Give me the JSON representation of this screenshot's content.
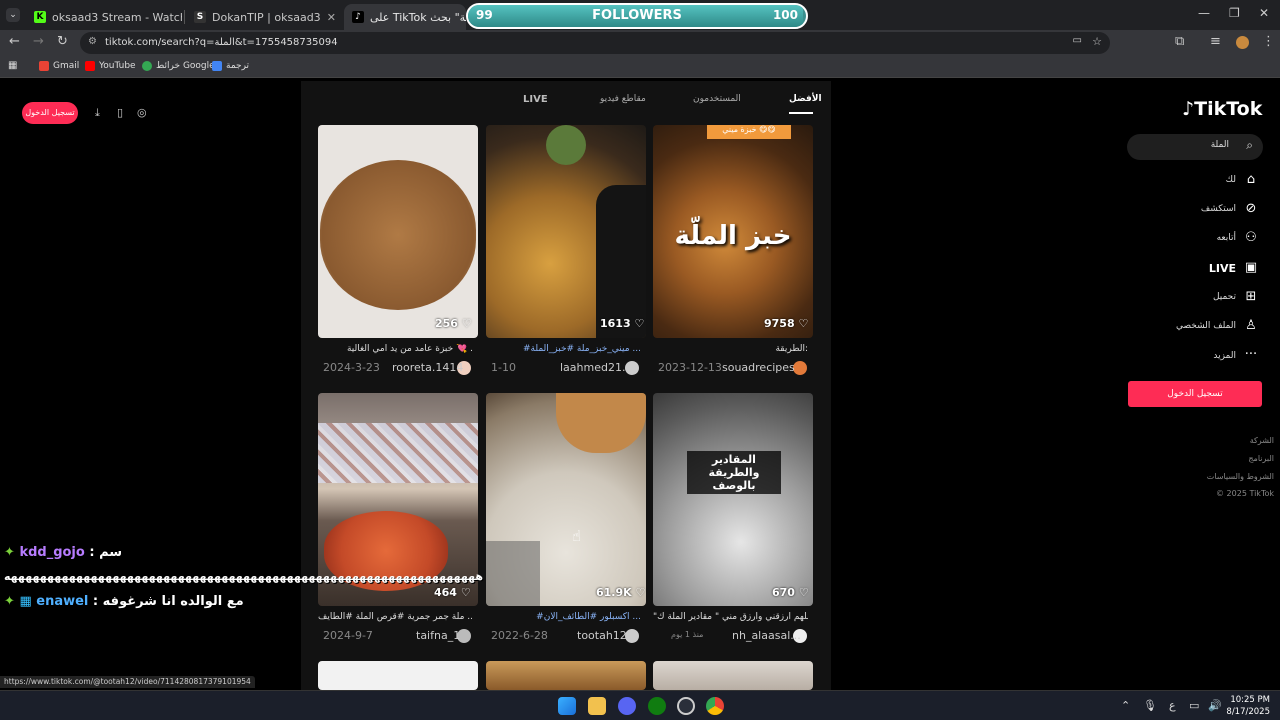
{
  "browser": {
    "tabs": [
      {
        "title": "oksaad3 Stream - Watch Live o",
        "favicon": "kick-icon"
      },
      {
        "title": "DokanTIP | oksaad3",
        "favicon": "dokan-icon"
      },
      {
        "title": "على TikTok على \"الملة\" بحث |",
        "favicon": "tiktok-icon"
      }
    ],
    "url": "tiktok.com/search?q=الملة&t=1755458735094",
    "bookmarks": [
      "Gmail",
      "YouTube",
      "خرائط Google",
      "ترجمة"
    ]
  },
  "followers_bar": {
    "label": "FOLLOWERS",
    "current": "99",
    "goal": "100",
    "progress": 0.99
  },
  "tiktok": {
    "logo": "TikTok",
    "search_query": "الملة",
    "login_small": "تسجيل الدخول",
    "login_big": "تسجيل الدخول",
    "nav": [
      {
        "label": "لك",
        "icon": "home-icon"
      },
      {
        "label": "استكشف",
        "icon": "compass-icon"
      },
      {
        "label": "أتابعه",
        "icon": "user-follow-icon"
      },
      {
        "label": "LIVE",
        "icon": "live-tv-icon"
      },
      {
        "label": "تحميل",
        "icon": "upload-icon"
      },
      {
        "label": "الملف الشخصي",
        "icon": "profile-icon"
      },
      {
        "label": "المزيد",
        "icon": "more-dots-icon"
      }
    ],
    "footer": [
      "الشركة",
      "البرنامج",
      "الشروط والسياسات",
      "© 2025 TikTok"
    ],
    "search_tabs": [
      "الأفضل",
      "المستخدمون",
      "مقاطع فيديو",
      "LIVE"
    ],
    "results": [
      {
        "likes": "9758",
        "caption": "الطريقة:",
        "user": "souadrecipes",
        "date": "2023-12-13",
        "overlay": "خبز الملّة",
        "badge": "خبزة ميني 😋😋"
      },
      {
        "likes": "1613",
        "caption": "#ميني_خبز_ملة #خبز_الملة ...",
        "user": "laahmed21...",
        "date": "1-10",
        "overlay": "",
        "badge": ""
      },
      {
        "likes": "256",
        "caption": "خبزة عامد من يد أمي الغالية 💘 .",
        "user": "rooreta.1414",
        "date": "2024-3-23",
        "overlay": "",
        "badge": ""
      },
      {
        "likes": "670",
        "caption": "\"اللهم ارزقني وارزق مني \" مقادير الملة ك...",
        "user": "nh_alaasal...",
        "date": "منذ 1 يوم",
        "overlay": "المقادير والطريقة بالوصف",
        "badge": ""
      },
      {
        "likes": "61.9K",
        "caption": "#اكسبلور #الطائف_الان ...",
        "user": "tootah12",
        "date": "2022-6-28",
        "overlay": "",
        "badge": ""
      },
      {
        "likes": "464",
        "caption": "ملة جمر جمرية #قرص الملة #الطايف ...",
        "user": "taifna_1",
        "date": "2024-9-7",
        "overlay": "",
        "badge": ""
      }
    ]
  },
  "chat": [
    {
      "user": "kdd_gojo",
      "message": "سم"
    },
    {
      "user": "",
      "message": "هههههههههههههههههههههههههههههههههههههههههههههههههههههههههههههههههه"
    },
    {
      "user": "enawel",
      "message": "مع الوالده انا شرغوفه"
    }
  ],
  "status_url": "https://www.tiktok.com/@tootah12/video/7114280817379101954",
  "clock": {
    "time": "10:25 PM",
    "date": "8/17/2025"
  },
  "tray_lang": "ع"
}
